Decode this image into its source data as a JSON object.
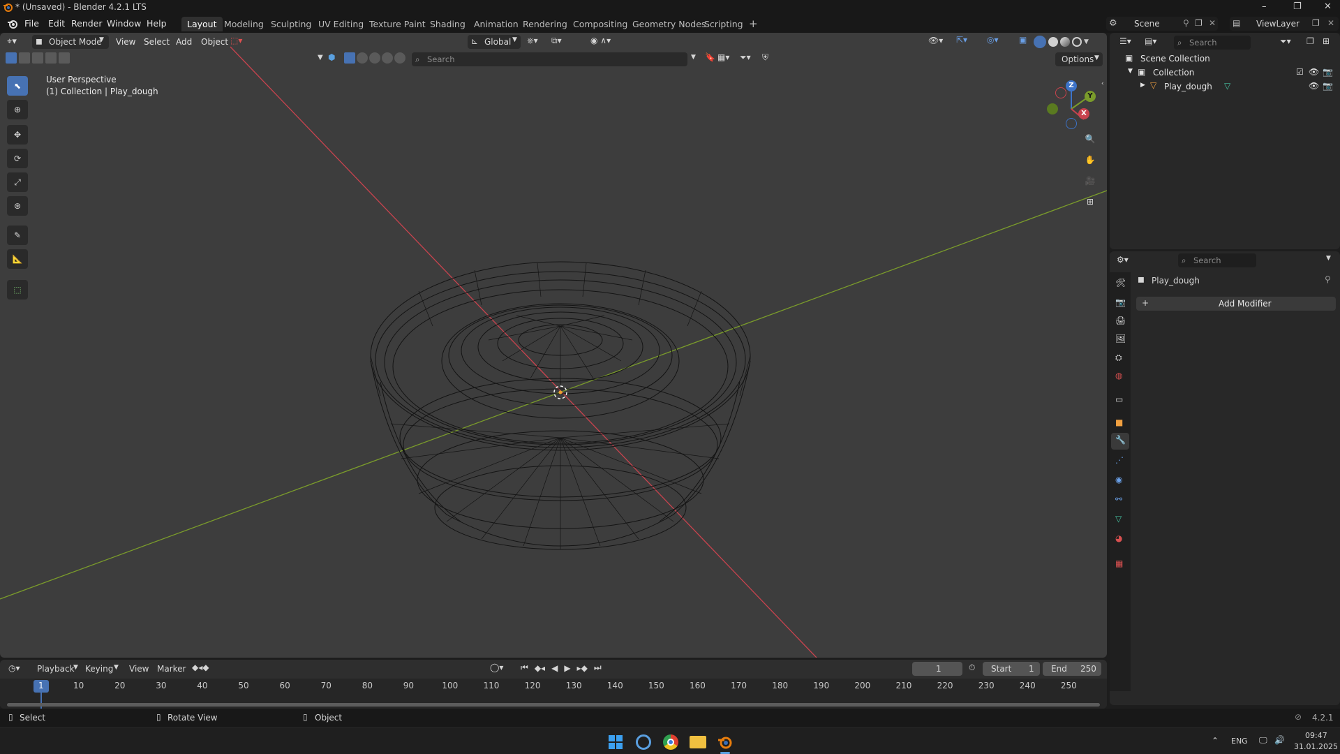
{
  "titlebar": {
    "title": "* (Unsaved) - Blender 4.2.1 LTS",
    "minimize": "–",
    "maximize": "❐",
    "close": "✕"
  },
  "menu": {
    "items": [
      "File",
      "Edit",
      "Render",
      "Window",
      "Help"
    ],
    "workspaces": [
      "Layout",
      "Modeling",
      "Sculpting",
      "UV Editing",
      "Texture Paint",
      "Shading",
      "Animation",
      "Rendering",
      "Compositing",
      "Geometry Nodes",
      "Scripting"
    ],
    "active_workspace": "Layout",
    "add_workspace": "+",
    "scene_label": "Scene",
    "viewlayer_label": "ViewLayer"
  },
  "viewport": {
    "mode": "Object Mode",
    "menus": [
      "View",
      "Select",
      "Add",
      "Object"
    ],
    "orientation": "Global",
    "search_placeholder": "Search",
    "options_label": "Options",
    "perspective_label": "User Perspective",
    "collection_label": "(1) Collection | Play_dough",
    "axis_x": "X",
    "axis_y": "Y",
    "axis_z": "Z",
    "colors": {
      "x_axis": "#c8434e",
      "y_axis": "#7a9b2b",
      "z_axis": "#3d73c8",
      "wire": "#141414",
      "background": "#3d3d3d",
      "accent": "#4772b3"
    }
  },
  "outliner": {
    "search_placeholder": "Search",
    "scene_collection": "Scene Collection",
    "collection": "Collection",
    "object": "Play_dough"
  },
  "properties": {
    "search_placeholder": "Search",
    "object_name": "Play_dough",
    "add_modifier": "Add Modifier"
  },
  "timeline": {
    "menus": [
      "Playback",
      "Keying",
      "View",
      "Marker"
    ],
    "current_frame": "1",
    "start_label": "Start",
    "start_value": "1",
    "end_label": "End",
    "end_value": "250",
    "frame_marker": "1",
    "ticks": [
      "10",
      "20",
      "30",
      "40",
      "50",
      "60",
      "70",
      "80",
      "90",
      "100",
      "110",
      "120",
      "130",
      "140",
      "150",
      "160",
      "170",
      "180",
      "190",
      "200",
      "210",
      "220",
      "230",
      "240",
      "250"
    ]
  },
  "statusbar": {
    "select": "Select",
    "rotate": "Rotate View",
    "object": "Object",
    "version": "4.2.1"
  },
  "taskbar": {
    "language": "ENG",
    "time": "09:47",
    "date": "31.01.2025"
  }
}
